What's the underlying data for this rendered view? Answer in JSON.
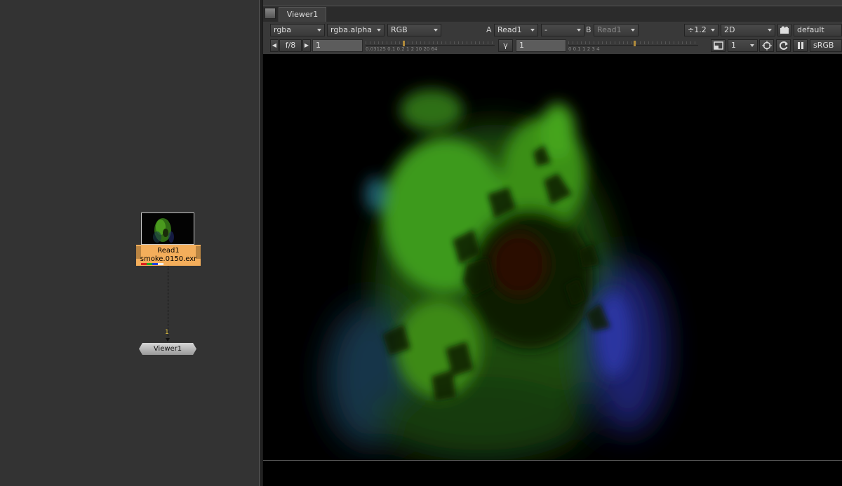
{
  "node_graph": {
    "read_node": {
      "name": "Read1",
      "file": "smoke.0150.exr",
      "channel_colors": [
        "#e02020",
        "#20b020",
        "#2040e0",
        "#f0f0f0"
      ]
    },
    "pipe_label": "1",
    "viewer_node": {
      "name": "Viewer1"
    }
  },
  "viewer": {
    "tab_label": "Viewer1",
    "toolbar1": {
      "layer": "rgba",
      "alpha_channel": "rgba.alpha",
      "display_channels": "RGB",
      "a_label": "A",
      "a_input": "Read1",
      "operation": "-",
      "b_label": "B",
      "b_input": "Read1",
      "downscale": "÷1.2",
      "view_mode": "2D",
      "lut_preset": "default"
    },
    "toolbar2": {
      "fstop": "f/8",
      "gain_value": "1",
      "gain_ticks": "0.03125 0.1 0.2   1  2       10  20  64",
      "gain_fraction": 0.29,
      "gamma_label": "γ",
      "gamma_value": "1",
      "gamma_ticks": "0      0.1               1          2      3     4",
      "gamma_fraction": 0.5,
      "proxy_value": "1",
      "colorspace": "sRGB"
    }
  }
}
